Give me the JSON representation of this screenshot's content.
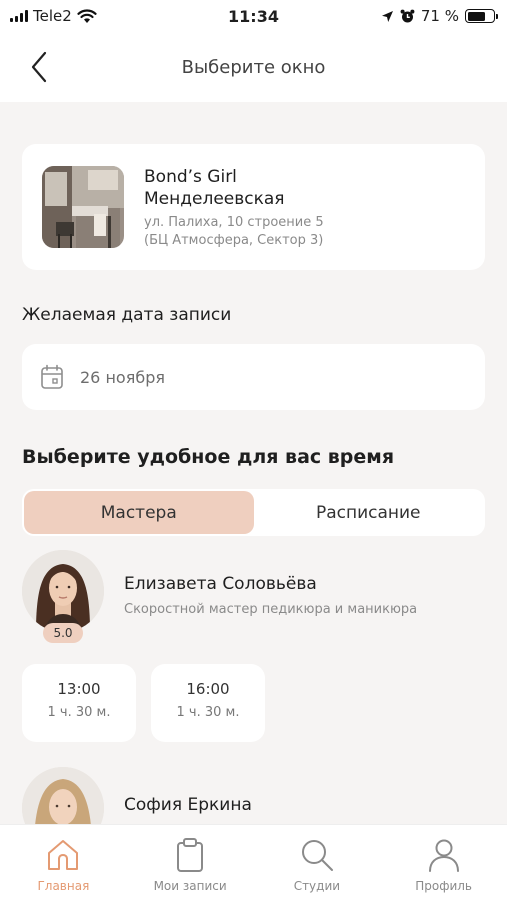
{
  "status_bar": {
    "carrier": "Tele2",
    "time": "11:34",
    "battery_percent": "71 %",
    "battery_level": 0.71
  },
  "header": {
    "title": "Выберите окно",
    "back_icon": "chevron-left-icon"
  },
  "studio": {
    "name_line1": "Bond’s Girl",
    "name_line2": "Менделеевская",
    "address_line1": "ул. Палиха, 10 строение 5",
    "address_line2": "(БЦ Атмосфера, Сектор 3)"
  },
  "date": {
    "label": "Желаемая дата записи",
    "value": "26 ноября",
    "icon": "calendar-icon"
  },
  "time_section": {
    "heading": "Выберите удобное для вас время",
    "tabs": [
      {
        "label": "Мастера",
        "active": true
      },
      {
        "label": "Расписание",
        "active": false
      }
    ]
  },
  "masters": [
    {
      "name": "Елизавета Соловьёва",
      "role": "Скоростной мастер педикюра и маникюра",
      "rating": "5.0",
      "slots": [
        {
          "time": "13:00",
          "duration": "1 ч. 30 м."
        },
        {
          "time": "16:00",
          "duration": "1 ч. 30 м."
        }
      ]
    },
    {
      "name": "София Еркина"
    }
  ],
  "tab_bar": {
    "items": [
      {
        "label": "Главная",
        "icon": "home-icon",
        "active": true
      },
      {
        "label": "Мои записи",
        "icon": "clipboard-icon",
        "active": false
      },
      {
        "label": "Студии",
        "icon": "search-icon",
        "active": false
      },
      {
        "label": "Профиль",
        "icon": "profile-icon",
        "active": false
      }
    ]
  },
  "colors": {
    "accent": "#efcfbf",
    "active_tab": "#e49a72",
    "background": "#f6f4f3"
  }
}
